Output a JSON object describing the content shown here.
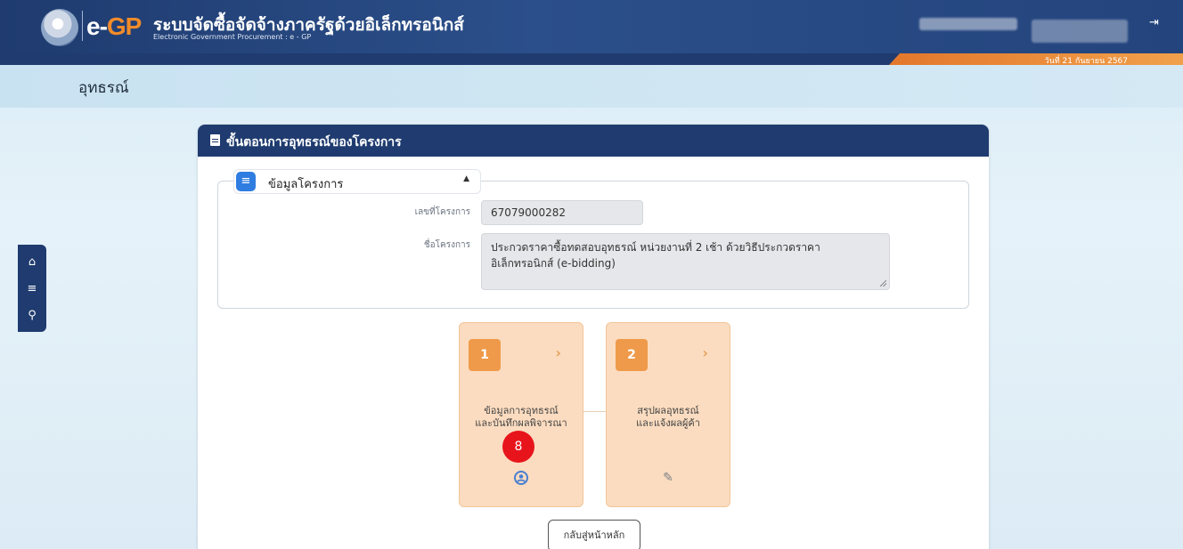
{
  "header": {
    "logo_text_e": "e-",
    "logo_text_gp": "GP",
    "title": "ระบบจัดซื้อจัดจ้างภาครัฐด้วยอิเล็กทรอนิกส์",
    "subtitle": "Electronic Government Procurement : e - GP",
    "date": "วันที่ 21 กันยายน 2567",
    "logout_icon": "logout-icon"
  },
  "page": {
    "title": "อุทธรณ์"
  },
  "sidenav": {
    "items": [
      {
        "icon": "home-icon",
        "glyph": "⌂"
      },
      {
        "icon": "menu-icon",
        "glyph": "≡"
      },
      {
        "icon": "search-icon",
        "glyph": "⚲"
      }
    ]
  },
  "panel": {
    "title": "ขั้นตอนการอุทธรณ์ของโครงการ",
    "section_title": "ข้อมูลโครงการ",
    "fields": [
      {
        "label": "เลขที่โครงการ",
        "value": "67079000282"
      },
      {
        "label": "ชื่อโครงการ",
        "value": "ประกวดราคาซื้อทดสอบอุทธรณ์ หน่วยงานที่ 2 เช้า ด้วยวิธีประกวดราคาอิเล็กทรอนิกส์ (e-bidding)"
      }
    ]
  },
  "steps": [
    {
      "number": "1",
      "line1": "ข้อมูลการอุทธรณ์",
      "line2": "และบันทึกผลพิจารณา",
      "icon": "user-circle-icon",
      "glyph": "●"
    },
    {
      "number": "2",
      "line1": "สรุปผลอุทธรณ์",
      "line2": "และแจ้งผลผู้ค้า",
      "icon": "edit-icon",
      "glyph": "✎"
    }
  ],
  "badge": {
    "value": "8"
  },
  "back_button": {
    "label": "กลับสู่หน้าหลัก"
  },
  "colors": {
    "navy": "#1f3b6f",
    "orange": "#f18b2b",
    "step_card": "#fbdcc0",
    "badge": "#e8141c"
  }
}
